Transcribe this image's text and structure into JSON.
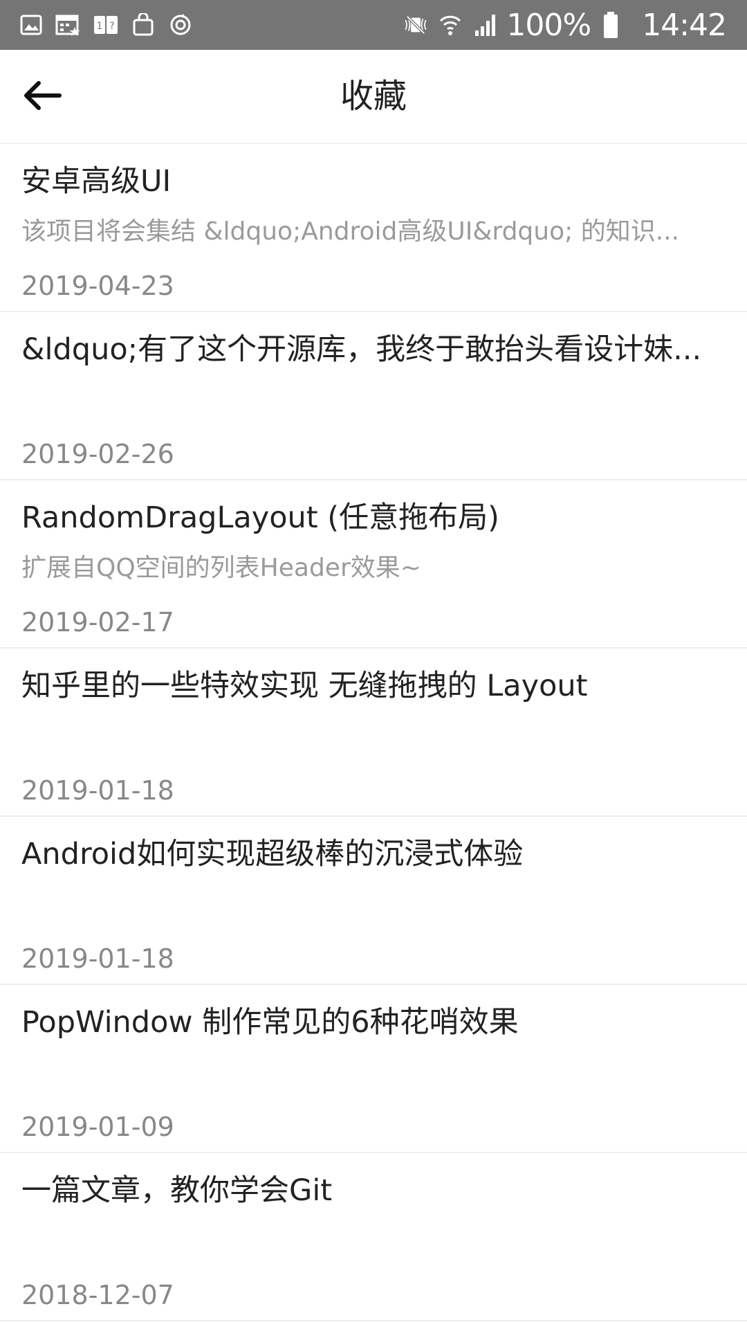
{
  "status_bar": {
    "left_icons": [
      "gallery-icon",
      "calendar-icon",
      "sim-card-icon",
      "shopping-bag-icon",
      "sync-icon"
    ],
    "right_icons": [
      "mute-vibrate-icon",
      "wifi-icon",
      "signal-icon"
    ],
    "battery": "100%",
    "time": "14:42"
  },
  "app_bar": {
    "back_icon": "arrow-left-icon",
    "title": "收藏"
  },
  "items": [
    {
      "title": "安卓高级UI",
      "desc": "该项目将会集结 &ldquo;Android高级UI&rdquo; 的知识...",
      "date": "2019-04-23"
    },
    {
      "title": "&ldquo;有了这个开源库，我终于敢抬头看设计妹...",
      "desc": "",
      "date": "2019-02-26"
    },
    {
      "title": "RandomDragLayout (任意拖布局)",
      "desc": "扩展自QQ空间的列表Header效果~",
      "date": "2019-02-17"
    },
    {
      "title": "知乎里的一些特效实现 无缝拖拽的 Layout",
      "desc": "",
      "date": "2019-01-18"
    },
    {
      "title": "Android如何实现超级棒的沉浸式体验",
      "desc": "",
      "date": "2019-01-18"
    },
    {
      "title": "PopWindow 制作常见的6种花哨效果",
      "desc": "",
      "date": "2019-01-09"
    },
    {
      "title": "一篇文章，教你学会Git",
      "desc": "",
      "date": "2018-12-07"
    }
  ]
}
